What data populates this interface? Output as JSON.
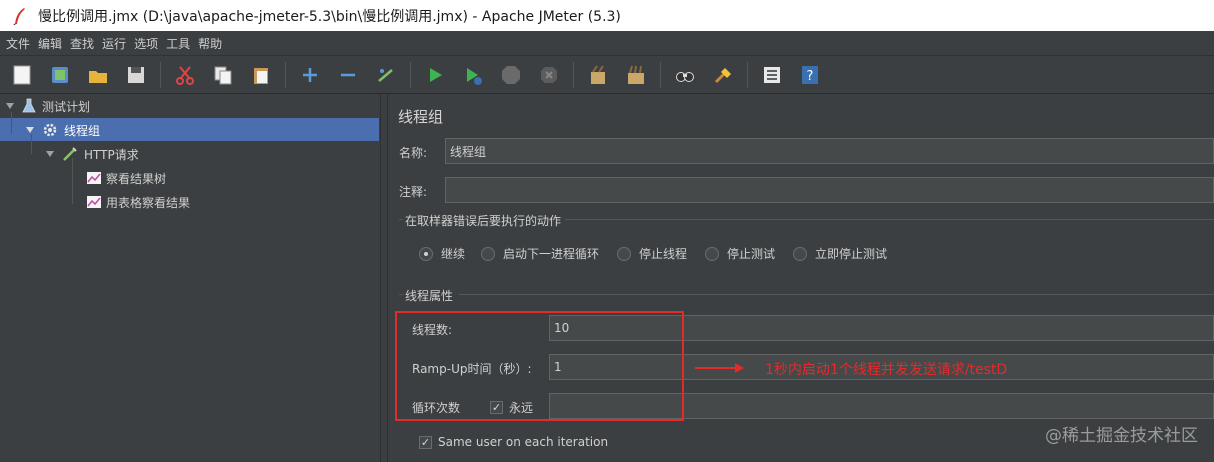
{
  "window": {
    "title": "慢比例调用.jmx (D:\\java\\apache-jmeter-5.3\\bin\\慢比例调用.jmx) - Apache JMeter (5.3)"
  },
  "menu": [
    "文件",
    "编辑",
    "查找",
    "运行",
    "选项",
    "工具",
    "帮助"
  ],
  "toolbar": {
    "icons": [
      "new-icon",
      "templates-icon",
      "open-icon",
      "save-icon",
      "cut-icon",
      "copy-icon",
      "paste-icon",
      "expand-icon",
      "collapse-icon",
      "toggle-icon",
      "start-icon",
      "start-no-pause-icon",
      "stop-icon",
      "shutdown-icon",
      "clear-icon",
      "clear-all-icon",
      "search-icon",
      "reset-search-icon",
      "function-helper-icon",
      "help-icon"
    ]
  },
  "tree": {
    "items": [
      {
        "label": "测试计划",
        "icon": "flask-icon"
      },
      {
        "label": "线程组",
        "icon": "gear-icon"
      },
      {
        "label": "HTTP请求",
        "icon": "dropper-icon"
      },
      {
        "label": "察看结果树",
        "icon": "chart-icon"
      },
      {
        "label": "用表格察看结果",
        "icon": "chart-icon"
      }
    ]
  },
  "panel": {
    "title": "线程组",
    "name_label": "名称:",
    "name_value": "线程组",
    "comment_label": "注释:",
    "comment_value": "",
    "error_section": "在取样器错误后要执行的动作",
    "error_actions": [
      "继续",
      "启动下一进程循环",
      "停止线程",
      "停止测试",
      "立即停止测试"
    ],
    "selected_action": "继续",
    "props_section": "线程属性",
    "threads_label": "线程数:",
    "threads_value": "10",
    "rampup_label": "Ramp-Up时间（秒）:",
    "rampup_value": "1",
    "loop_label": "循环次数",
    "forever_label": "永远",
    "forever_checked": true,
    "same_user_label": "Same user on each iteration",
    "same_user_checked": true
  },
  "annotation": {
    "text": "1秒内启动1个线程并发发送请求/testD",
    "color": "#e52a2a"
  },
  "watermark": "@稀土掘金技术社区"
}
